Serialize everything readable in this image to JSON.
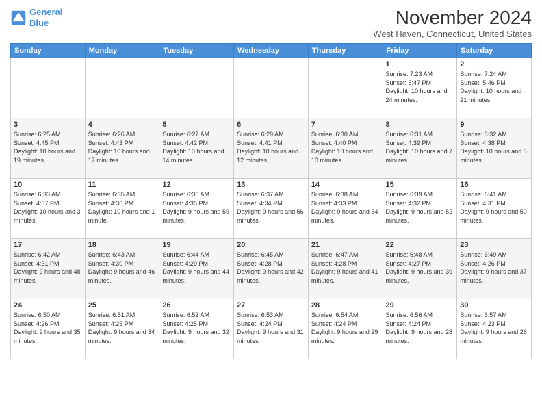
{
  "header": {
    "logo_line1": "General",
    "logo_line2": "Blue",
    "month_title": "November 2024",
    "subtitle": "West Haven, Connecticut, United States"
  },
  "weekdays": [
    "Sunday",
    "Monday",
    "Tuesday",
    "Wednesday",
    "Thursday",
    "Friday",
    "Saturday"
  ],
  "weeks": [
    [
      {
        "day": "",
        "info": ""
      },
      {
        "day": "",
        "info": ""
      },
      {
        "day": "",
        "info": ""
      },
      {
        "day": "",
        "info": ""
      },
      {
        "day": "",
        "info": ""
      },
      {
        "day": "1",
        "info": "Sunrise: 7:23 AM\nSunset: 5:47 PM\nDaylight: 10 hours and 24 minutes."
      },
      {
        "day": "2",
        "info": "Sunrise: 7:24 AM\nSunset: 5:46 PM\nDaylight: 10 hours and 21 minutes."
      }
    ],
    [
      {
        "day": "3",
        "info": "Sunrise: 6:25 AM\nSunset: 4:45 PM\nDaylight: 10 hours and 19 minutes."
      },
      {
        "day": "4",
        "info": "Sunrise: 6:26 AM\nSunset: 4:43 PM\nDaylight: 10 hours and 17 minutes."
      },
      {
        "day": "5",
        "info": "Sunrise: 6:27 AM\nSunset: 4:42 PM\nDaylight: 10 hours and 14 minutes."
      },
      {
        "day": "6",
        "info": "Sunrise: 6:29 AM\nSunset: 4:41 PM\nDaylight: 10 hours and 12 minutes."
      },
      {
        "day": "7",
        "info": "Sunrise: 6:30 AM\nSunset: 4:40 PM\nDaylight: 10 hours and 10 minutes."
      },
      {
        "day": "8",
        "info": "Sunrise: 6:31 AM\nSunset: 4:39 PM\nDaylight: 10 hours and 7 minutes."
      },
      {
        "day": "9",
        "info": "Sunrise: 6:32 AM\nSunset: 4:38 PM\nDaylight: 10 hours and 5 minutes."
      }
    ],
    [
      {
        "day": "10",
        "info": "Sunrise: 6:33 AM\nSunset: 4:37 PM\nDaylight: 10 hours and 3 minutes."
      },
      {
        "day": "11",
        "info": "Sunrise: 6:35 AM\nSunset: 4:36 PM\nDaylight: 10 hours and 1 minute."
      },
      {
        "day": "12",
        "info": "Sunrise: 6:36 AM\nSunset: 4:35 PM\nDaylight: 9 hours and 59 minutes."
      },
      {
        "day": "13",
        "info": "Sunrise: 6:37 AM\nSunset: 4:34 PM\nDaylight: 9 hours and 56 minutes."
      },
      {
        "day": "14",
        "info": "Sunrise: 6:38 AM\nSunset: 4:33 PM\nDaylight: 9 hours and 54 minutes."
      },
      {
        "day": "15",
        "info": "Sunrise: 6:39 AM\nSunset: 4:32 PM\nDaylight: 9 hours and 52 minutes."
      },
      {
        "day": "16",
        "info": "Sunrise: 6:41 AM\nSunset: 4:31 PM\nDaylight: 9 hours and 50 minutes."
      }
    ],
    [
      {
        "day": "17",
        "info": "Sunrise: 6:42 AM\nSunset: 4:31 PM\nDaylight: 9 hours and 48 minutes."
      },
      {
        "day": "18",
        "info": "Sunrise: 6:43 AM\nSunset: 4:30 PM\nDaylight: 9 hours and 46 minutes."
      },
      {
        "day": "19",
        "info": "Sunrise: 6:44 AM\nSunset: 4:29 PM\nDaylight: 9 hours and 44 minutes."
      },
      {
        "day": "20",
        "info": "Sunrise: 6:45 AM\nSunset: 4:28 PM\nDaylight: 9 hours and 42 minutes."
      },
      {
        "day": "21",
        "info": "Sunrise: 6:47 AM\nSunset: 4:28 PM\nDaylight: 9 hours and 41 minutes."
      },
      {
        "day": "22",
        "info": "Sunrise: 6:48 AM\nSunset: 4:27 PM\nDaylight: 9 hours and 39 minutes."
      },
      {
        "day": "23",
        "info": "Sunrise: 6:49 AM\nSunset: 4:26 PM\nDaylight: 9 hours and 37 minutes."
      }
    ],
    [
      {
        "day": "24",
        "info": "Sunrise: 6:50 AM\nSunset: 4:26 PM\nDaylight: 9 hours and 35 minutes."
      },
      {
        "day": "25",
        "info": "Sunrise: 6:51 AM\nSunset: 4:25 PM\nDaylight: 9 hours and 34 minutes."
      },
      {
        "day": "26",
        "info": "Sunrise: 6:52 AM\nSunset: 4:25 PM\nDaylight: 9 hours and 32 minutes."
      },
      {
        "day": "27",
        "info": "Sunrise: 6:53 AM\nSunset: 4:24 PM\nDaylight: 9 hours and 31 minutes."
      },
      {
        "day": "28",
        "info": "Sunrise: 6:54 AM\nSunset: 4:24 PM\nDaylight: 9 hours and 29 minutes."
      },
      {
        "day": "29",
        "info": "Sunrise: 6:56 AM\nSunset: 4:24 PM\nDaylight: 9 hours and 28 minutes."
      },
      {
        "day": "30",
        "info": "Sunrise: 6:57 AM\nSunset: 4:23 PM\nDaylight: 9 hours and 26 minutes."
      }
    ]
  ]
}
